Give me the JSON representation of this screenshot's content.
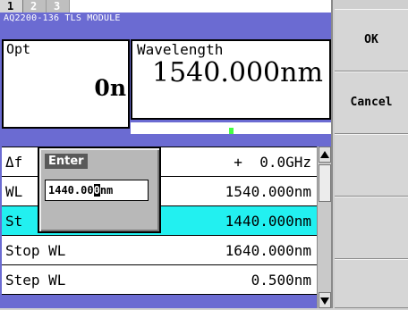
{
  "tabs": [
    {
      "label": "1",
      "active": true
    },
    {
      "label": "2",
      "active": false
    },
    {
      "label": "3",
      "active": false
    }
  ],
  "module": {
    "title": "AQ2200-136 TLS MODULE"
  },
  "opt": {
    "label": "Opt",
    "value": "0n"
  },
  "wavelength": {
    "label": "Wavelength",
    "value": "1540.000nm",
    "indicator_color": "#44ff44"
  },
  "rows": [
    {
      "label": "Δf",
      "value": "+  0.0GHz"
    },
    {
      "label": "WL",
      "value": "1540.000nm"
    },
    {
      "label": "St",
      "value": "1440.000nm"
    },
    {
      "label": "Stop WL",
      "value": "1640.000nm"
    },
    {
      "label": "Step WL",
      "value": "0.500nm"
    }
  ],
  "popup": {
    "title": "Enter",
    "input_before": "1440.00",
    "input_cursor": "0",
    "input_after": "nm"
  },
  "buttons": {
    "ok": "OK",
    "cancel": "Cancel"
  },
  "colors": {
    "panel": "#6b6bd2",
    "highlight": "#22f0f0"
  },
  "icons": {
    "scroll_up": "triangle-up",
    "scroll_down": "triangle-down"
  }
}
